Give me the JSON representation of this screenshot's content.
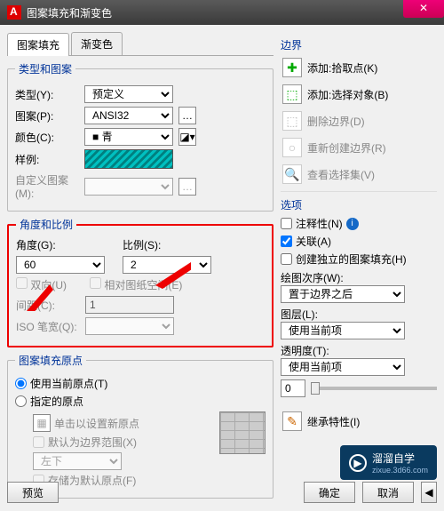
{
  "window": {
    "title": "图案填充和渐变色"
  },
  "tabs": {
    "hatch": "图案填充",
    "gradient": "渐变色"
  },
  "typePattern": {
    "legend": "类型和图案",
    "type_label": "类型(Y):",
    "type_value": "预定义",
    "pattern_label": "图案(P):",
    "pattern_value": "ANSI32",
    "color_label": "颜色(C):",
    "color_value": "青",
    "sample_label": "样例:",
    "custom_label": "自定义图案(M):"
  },
  "angleScale": {
    "legend": "角度和比例",
    "angle_label": "角度(G):",
    "angle_value": "60",
    "scale_label": "比例(S):",
    "scale_value": "2",
    "bidir_label": "双向(U)",
    "paperspace_label": "相对图纸空间(E)",
    "spacing_label": "间距(C):",
    "spacing_value": "1",
    "isowidth_label": "ISO 笔宽(Q):"
  },
  "origin": {
    "legend": "图案填充原点",
    "use_current": "使用当前原点(T)",
    "specified": "指定的原点",
    "click_set": "单击以设置新原点",
    "default_extent": "默认为边界范围(X)",
    "position_value": "左下",
    "store_default": "存储为默认原点(F)"
  },
  "boundary": {
    "legend": "边界",
    "add_pick": "添加:拾取点(K)",
    "add_select": "添加:选择对象(B)",
    "remove": "删除边界(D)",
    "recreate": "重新创建边界(R)",
    "view_sel": "查看选择集(V)"
  },
  "options": {
    "legend": "选项",
    "annotative": "注释性(N)",
    "associative": "关联(A)",
    "separate": "创建独立的图案填充(H)",
    "draworder_label": "绘图次序(W):",
    "draworder_value": "置于边界之后",
    "layer_label": "图层(L):",
    "layer_value": "使用当前项",
    "transparency_label": "透明度(T):",
    "transparency_value": "使用当前项",
    "transparency_num": "0",
    "inherit": "继承特性(I)"
  },
  "buttons": {
    "preview": "预览",
    "ok": "确定",
    "cancel": "取消"
  },
  "watermark": {
    "text": "溜溜自学",
    "url": "zixue.3d66.com"
  }
}
